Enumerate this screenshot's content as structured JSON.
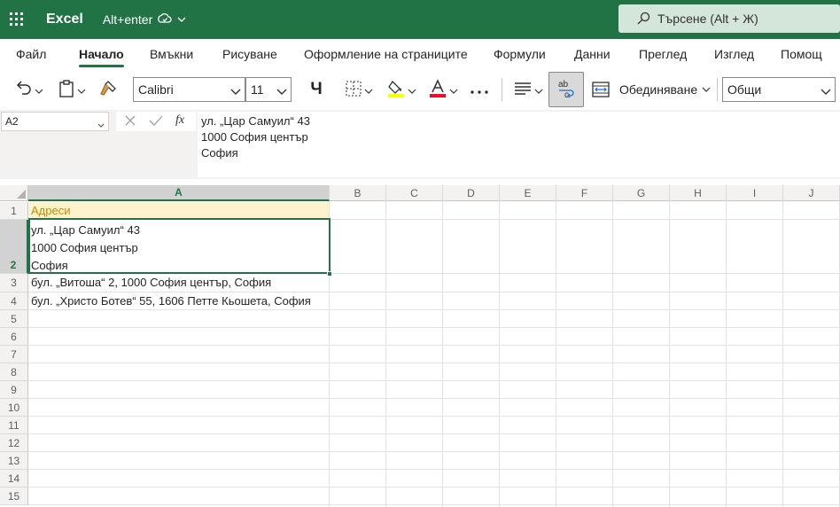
{
  "titlebar": {
    "app_name": "Excel",
    "doc_name": "Alt+enter",
    "search_placeholder": "Търсене (Alt + Ж)",
    "brand_color": "#217346"
  },
  "ribbon_tabs": [
    "Файл",
    "Начало",
    "Вмъкни",
    "Рисуване",
    "Оформление на страниците",
    "Формули",
    "Данни",
    "Преглед",
    "Изглед",
    "Помощ"
  ],
  "active_tab": "Начало",
  "toolbar": {
    "font_name": "Calibri",
    "font_size": "11",
    "bold_label": "Ч",
    "merge_label": "Обединяване",
    "number_format": "Общи",
    "font_color": "#e81123",
    "highlight_color": "#ffff00"
  },
  "formula_bar": {
    "name_box": "A2",
    "fx_label": "fx",
    "lines": [
      "ул. „Цар Самуил“ 43",
      "1000 София център",
      "София"
    ]
  },
  "columns": [
    "A",
    "B",
    "C",
    "D",
    "E",
    "F",
    "G",
    "H",
    "I",
    "J"
  ],
  "rows": [
    "1",
    "2",
    "3",
    "4",
    "5",
    "6",
    "7",
    "8",
    "9",
    "10",
    "11",
    "12",
    "13",
    "14",
    "15"
  ],
  "cells": {
    "a1": "Адреси",
    "a2_lines": [
      "ул. „Цар Самуил“ 43",
      "1000 София център",
      "София"
    ],
    "a3": "бул. „Витоша“ 2, 1000 София център, София",
    "a4": "бул. „Христо Ботев“ 55, 1606 Петте Кьошета, София"
  },
  "selected_cell": "A2"
}
